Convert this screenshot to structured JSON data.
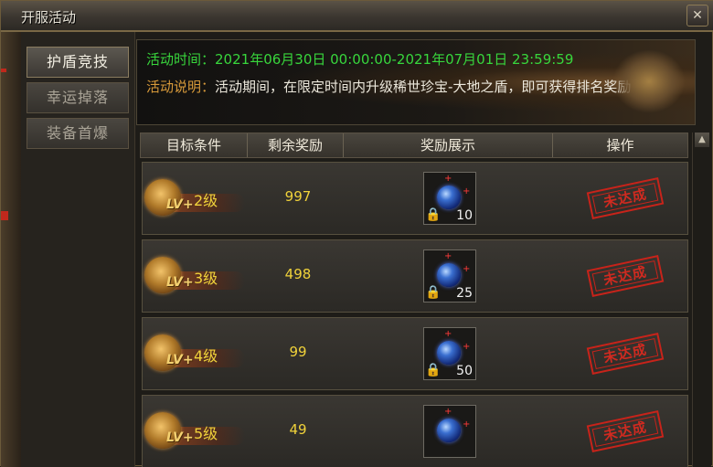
{
  "window": {
    "title": "开服活动",
    "close_icon": "close-icon"
  },
  "sidebar": {
    "tabs": [
      {
        "label": "护盾竞技",
        "active": true
      },
      {
        "label": "幸运掉落",
        "active": false
      },
      {
        "label": "装备首爆",
        "active": false
      }
    ]
  },
  "info": {
    "time_label": "活动时间：",
    "time_value": "2021年06月30日 00:00:00-2021年07月01日 23:59:59",
    "desc_label": "活动说明：",
    "desc_value": "活动期间，在限定时间内升级稀世珍宝-大地之盾，即可获得排名奖励"
  },
  "table": {
    "headers": [
      "目标条件",
      "剩余奖励",
      "奖励展示",
      "操作"
    ],
    "rows": [
      {
        "badge": "LV+",
        "level": "2级",
        "remaining": "997",
        "reward_qty": "10",
        "status": "未达成"
      },
      {
        "badge": "LV+",
        "level": "3级",
        "remaining": "498",
        "reward_qty": "25",
        "status": "未达成"
      },
      {
        "badge": "LV+",
        "level": "4级",
        "remaining": "99",
        "reward_qty": "50",
        "status": "未达成"
      },
      {
        "badge": "LV+",
        "level": "5级",
        "remaining": "49",
        "reward_qty": "",
        "status": "未达成"
      }
    ]
  },
  "colors": {
    "time_green": "#38d63c",
    "desc_orange": "#d89a3a",
    "level_yellow": "#f0d23a",
    "stamp_red": "#d02a20"
  }
}
